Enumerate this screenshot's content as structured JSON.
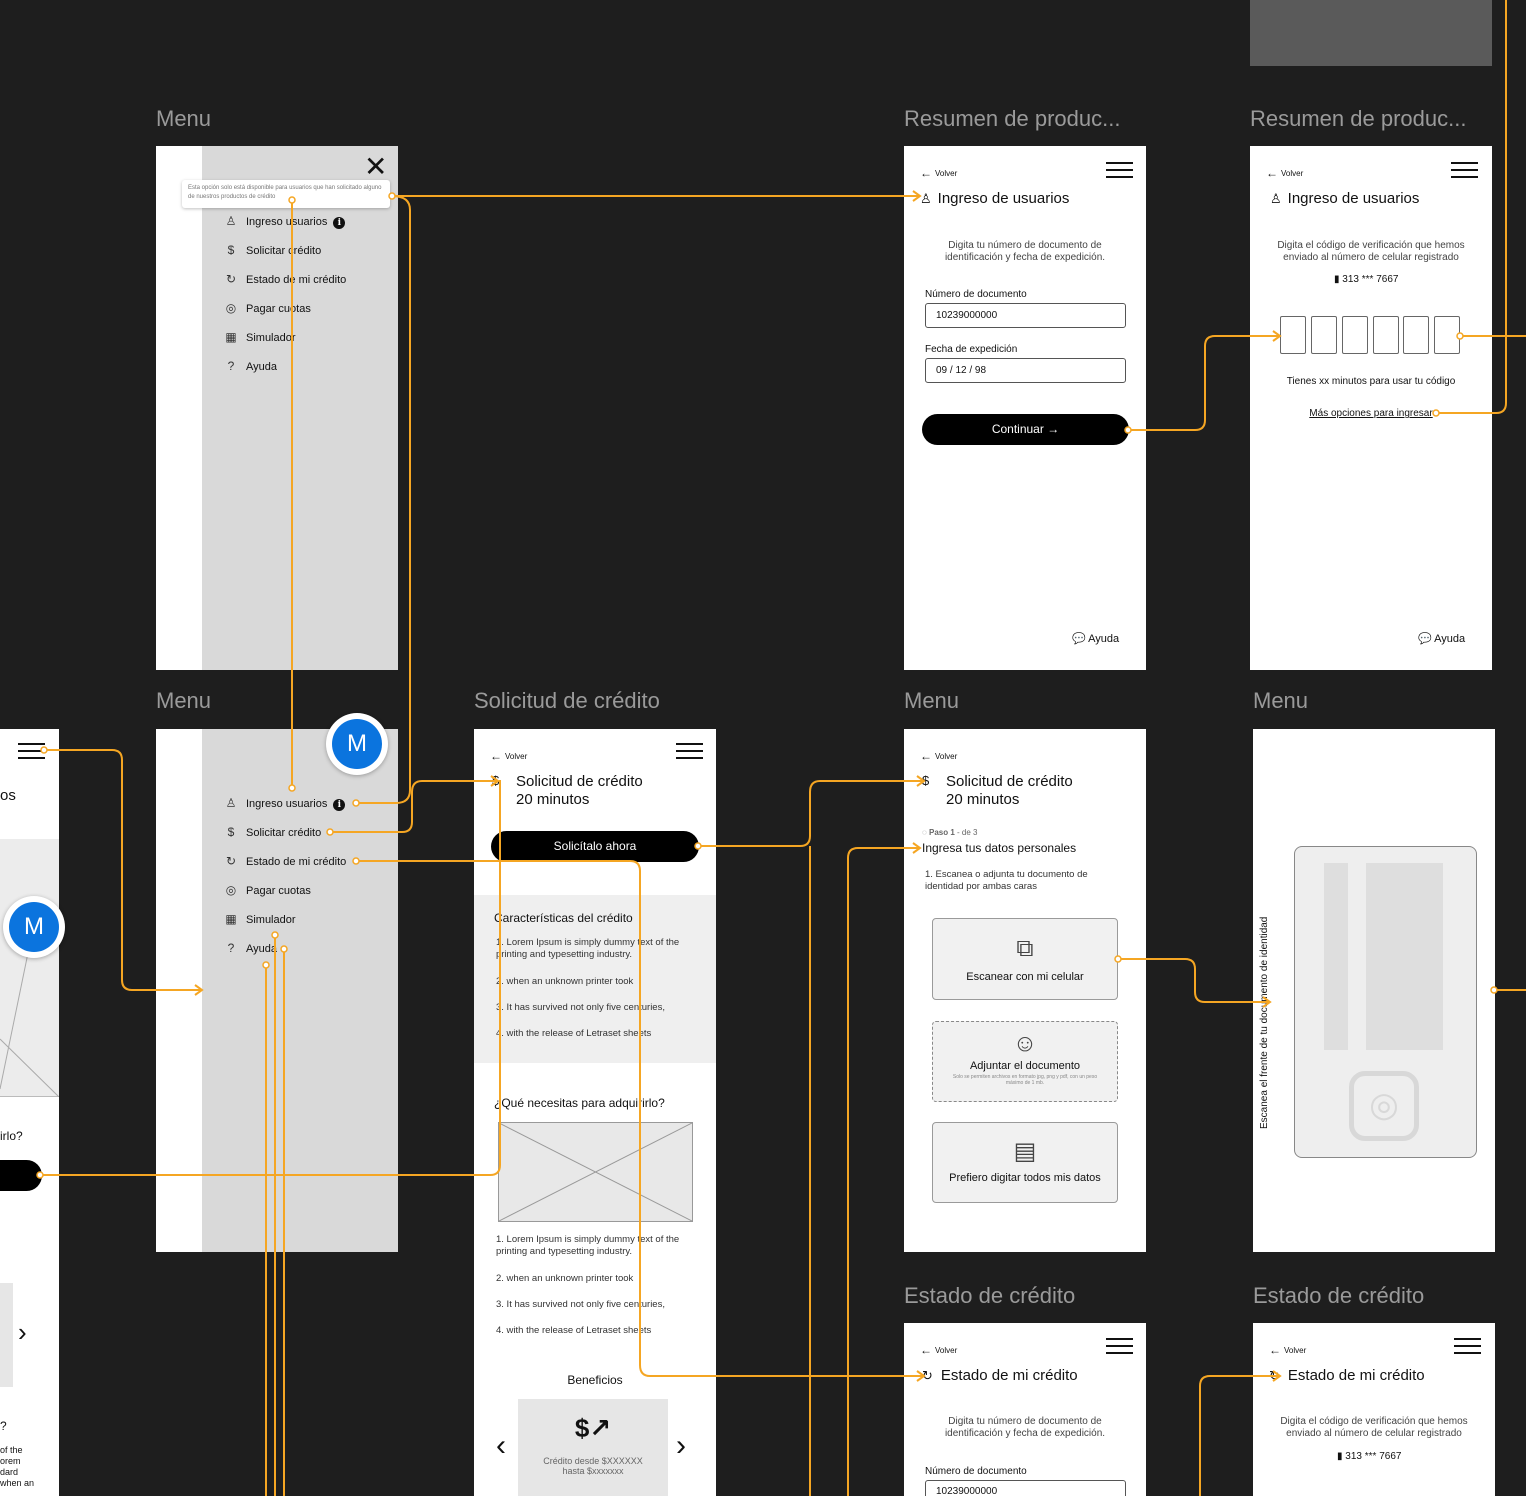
{
  "colors": {
    "canvas": "#1e1e1e",
    "wire": "#f5a623",
    "avatar": "#0b74de",
    "menu_panel": "#d9d9d9",
    "section_bg": "#efefef"
  },
  "labels": {
    "menu_a": "Menu",
    "resumen_a": "Resumen de produc...",
    "resumen_b": "Resumen de produc...",
    "menu_b": "Menu",
    "solicitud": "Solicitud de crédito",
    "menu_c": "Menu",
    "menu_d": "Menu",
    "estado_a": "Estado de crédito",
    "estado_b": "Estado de crédito"
  },
  "common": {
    "volver": "Volver",
    "ayuda": "Ayuda",
    "back_icon": "arrow-left-icon",
    "menu_icon": "hamburger-icon"
  },
  "menu_items": [
    {
      "label": "Ingreso usuarios",
      "icon": "user-icon"
    },
    {
      "label": "Solicitar crédito",
      "icon": "money-icon"
    },
    {
      "label": "Estado de mi crédito",
      "icon": "refresh-icon"
    },
    {
      "label": "Pagar cuotas",
      "icon": "coins-icon"
    },
    {
      "label": "Simulador",
      "icon": "calculator-icon"
    },
    {
      "label": "Ayuda",
      "icon": "help-bubble-icon"
    }
  ],
  "menu_tooltip": "Esta opción solo está disponible para usuarios que han solicitado alguno de nuestros productos de crédito",
  "login": {
    "title": "Ingreso de usuarios",
    "desc": "Digita tu número de documento de identificación y fecha de expedición.",
    "doc_label": "Número de documento",
    "doc_value": "10239000000",
    "date_label": "Fecha de expedición",
    "date_value": "09 / 12 / 98",
    "continue": "Continuar"
  },
  "verify": {
    "title": "Ingreso de usuarios",
    "desc": "Digita el código de verificación que hemos enviado al número de celular registrado",
    "phone": "313 *** 7667",
    "timer": "Tienes xx minutos para usar tu código",
    "more": "Más opciones para ingresar"
  },
  "avatar_letter": "M",
  "solicitud": {
    "title_1": "Solicitud de crédito",
    "title_2": "20 minutos",
    "cta": "Solicítalo ahora",
    "features_title": "Características del crédito",
    "features": [
      "1. Lorem Ipsum is simply dummy text of the printing and typesetting industry.",
      "2.  when an unknown printer took",
      "3. It has survived not only five centuries,",
      "4.  with the release of Letraset sheets"
    ],
    "needs_title": "¿Qué necesitas para adquirirlo?",
    "needs": [
      "1. Lorem Ipsum is simply dummy text of the printing and typesetting industry.",
      "2.  when an unknown printer took",
      "3. It has survived not only five centuries,",
      "4.  with the release of Letraset sheets"
    ],
    "benefits_title": "Beneficios",
    "benefit_text_1": "Crédito desde $XXXXXX",
    "benefit_text_2": "hasta $xxxxxxx"
  },
  "steps": {
    "title_1": "Solicitud de crédito",
    "title_2": "20 minutos",
    "step_bold": "Paso 1",
    "step_rest": " - de 3",
    "heading": "Ingresa tus datos personales",
    "instruction": "1. Escanea o adjunta tu documento de identidad por ambas caras",
    "scan": "Escanear con mi celular",
    "attach": "Adjuntar el documento",
    "attach_note": "Solo se permiten archivos en formato jpg, png y pdf, con un peso máximo de 1 mb.",
    "manual": "Prefiero digitar todos mis datos"
  },
  "scan_screen": {
    "vertical_text": "Escanea el frente de tu documento de identidad"
  },
  "estado": {
    "title": "Estado de mi crédito",
    "desc": "Digita tu número de documento de identificación y fecha de expedición.",
    "doc_label": "Número de documento",
    "doc_value": "10239000000",
    "desc_b": "Digita el código de verificación que hemos enviado al número de celular registrado",
    "phone": "313 *** 7667"
  },
  "partial_left": {
    "title_end": "os",
    "question_end": "irlo?",
    "q2": "?",
    "lines": [
      "of the",
      "orem",
      "dard",
      "when an"
    ]
  }
}
